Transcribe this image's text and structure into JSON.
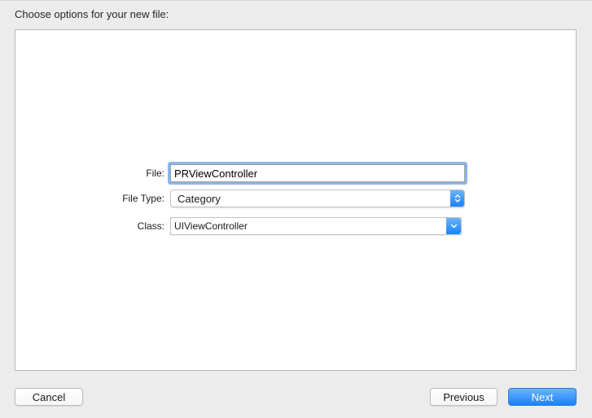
{
  "dialog": {
    "header": "Choose options for your new file:"
  },
  "form": {
    "file": {
      "label": "File:",
      "value": "PRViewController"
    },
    "file_type": {
      "label": "File Type:",
      "value": "Category"
    },
    "class": {
      "label": "Class:",
      "value": "UIViewController"
    }
  },
  "buttons": {
    "cancel": "Cancel",
    "previous": "Previous",
    "next": "Next"
  },
  "colors": {
    "accent": "#1a82fb",
    "focus_ring": "#8ab6ea"
  },
  "icons": {
    "file_type_arrow": "chevron-up-down-icon",
    "class_arrow": "chevron-down-icon"
  }
}
